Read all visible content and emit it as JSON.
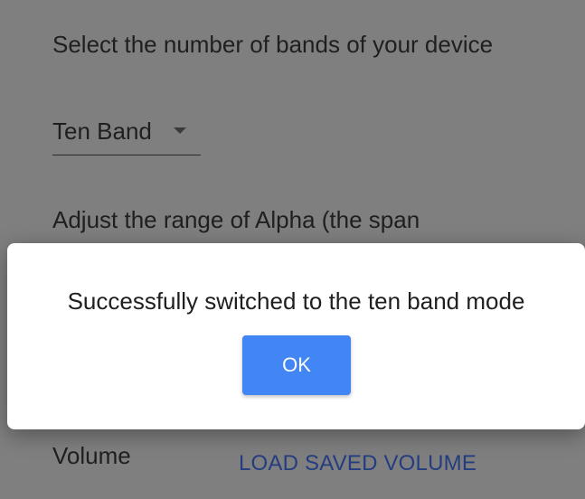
{
  "settings": {
    "bands_prompt": "Select the number of bands of your device",
    "bands_selected": "Ten Band",
    "alpha_prompt": "Adjust the range of Alpha (the span",
    "volume_label": "Volume",
    "load_volume_label": "LOAD SAVED VOLUME"
  },
  "dialog": {
    "message": "Successfully switched to the ten band mode",
    "ok_label": "OK"
  },
  "colors": {
    "overlay": "#7f7f7f",
    "accent": "#4285f4",
    "link": "#243d80"
  },
  "icons": {
    "select_caret": "dropdown-caret-icon"
  }
}
